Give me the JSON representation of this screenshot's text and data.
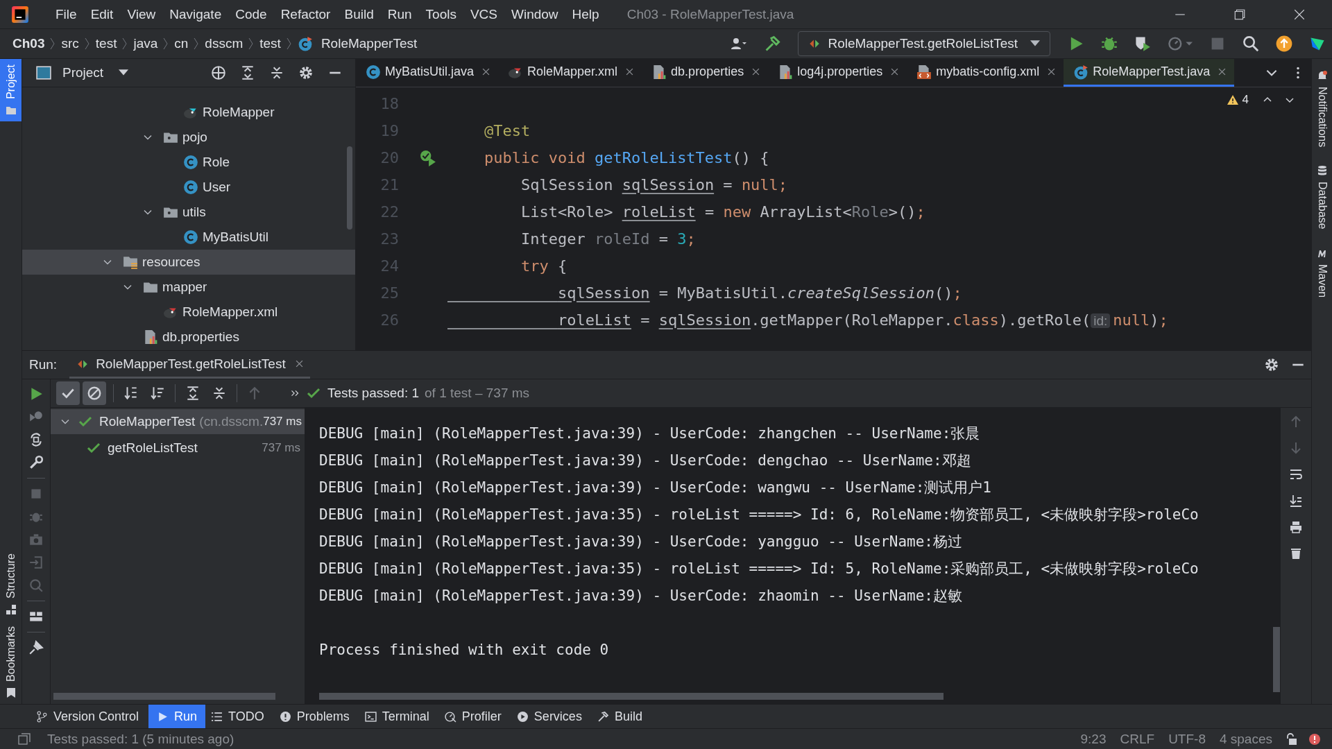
{
  "menu": [
    "File",
    "Edit",
    "View",
    "Navigate",
    "Code",
    "Refactor",
    "Build",
    "Run",
    "Tools",
    "VCS",
    "Window",
    "Help"
  ],
  "window_title": "Ch03 - RoleMapperTest.java",
  "breadcrumbs": [
    {
      "label": "Ch03",
      "kind": "project"
    },
    {
      "label": "src",
      "kind": "dir"
    },
    {
      "label": "test",
      "kind": "dir"
    },
    {
      "label": "java",
      "kind": "dir"
    },
    {
      "label": "cn",
      "kind": "dir"
    },
    {
      "label": "dsscm",
      "kind": "dir"
    },
    {
      "label": "test",
      "kind": "dir"
    },
    {
      "label": "RoleMapperTest",
      "kind": "test-class"
    }
  ],
  "run_config": "RoleMapperTest.getRoleListTest",
  "left_stripe": {
    "top": [
      {
        "label": "Project",
        "selected": true
      }
    ],
    "bottom": [
      {
        "label": "Structure",
        "selected": false
      },
      {
        "label": "Bookmarks",
        "selected": false
      }
    ]
  },
  "right_stripe": [
    {
      "label": "Notifications",
      "kind": "bell"
    },
    {
      "label": "Database",
      "kind": "database"
    },
    {
      "label": "Maven",
      "kind": "maven"
    }
  ],
  "project_panel": {
    "title": "Project",
    "tree_continued": [
      {
        "label": "RoleMapper",
        "kind": "mapper-interface",
        "selected": false
      },
      {
        "label": "pojo",
        "kind": "package",
        "selected": false,
        "expanded": true,
        "children": [
          {
            "label": "Role",
            "kind": "class",
            "selected": false
          },
          {
            "label": "User",
            "kind": "class",
            "selected": false
          }
        ]
      },
      {
        "label": "utils",
        "kind": "package",
        "selected": false,
        "expanded": true,
        "children": [
          {
            "label": "MyBatisUtil",
            "kind": "class",
            "selected": false
          }
        ]
      }
    ],
    "tree": [
      {
        "label": "resources",
        "kind": "resources",
        "selected": true,
        "expanded": true,
        "children": [
          {
            "label": "mapper",
            "kind": "folder",
            "selected": false,
            "expanded": true,
            "children": [
              {
                "label": "RoleMapper.xml",
                "kind": "mapper-xml",
                "selected": false
              }
            ]
          },
          {
            "label": "db.properties",
            "kind": "properties",
            "selected": false
          }
        ]
      }
    ]
  },
  "editor_tabs": [
    {
      "label": "MyBatisUtil.java",
      "kind": "class",
      "selected": false
    },
    {
      "label": "RoleMapper.xml",
      "kind": "mapper-xml",
      "selected": false
    },
    {
      "label": "db.properties",
      "kind": "properties",
      "selected": false
    },
    {
      "label": "log4j.properties",
      "kind": "properties",
      "selected": false
    },
    {
      "label": "mybatis-config.xml",
      "kind": "xml",
      "selected": false
    },
    {
      "label": "RoleMapperTest.java",
      "kind": "test-class",
      "selected": true
    }
  ],
  "editor": {
    "warnings": "4",
    "lines": [
      {
        "number": "18",
        "run_gutter": false
      },
      {
        "number": "19",
        "run_gutter": false,
        "tokens": [
          {
            "text": "    @Test",
            "kind": "annotation"
          }
        ]
      },
      {
        "number": "20",
        "run_gutter": true,
        "tokens": [
          {
            "text": "    public void ",
            "kind": "keyword"
          },
          {
            "text": "getRoleListTest",
            "kind": "decl"
          },
          {
            "text": "() {",
            "kind": "plain"
          }
        ]
      },
      {
        "number": "21",
        "run_gutter": false,
        "tokens": [
          {
            "text": "        SqlSession ",
            "kind": "plain"
          },
          {
            "text": "sqlSession",
            "kind": "var"
          },
          {
            "text": " = ",
            "kind": "plain"
          },
          {
            "text": "null",
            "kind": "keyword"
          },
          {
            "text": ";",
            "kind": "keyword"
          }
        ]
      },
      {
        "number": "22",
        "run_gutter": false,
        "tokens": [
          {
            "text": "        List<Role> ",
            "kind": "plain"
          },
          {
            "text": "roleList",
            "kind": "var"
          },
          {
            "text": " = ",
            "kind": "plain"
          },
          {
            "text": "new ",
            "kind": "keyword"
          },
          {
            "text": "ArrayList<",
            "kind": "plain"
          },
          {
            "text": "Role",
            "kind": "muted"
          },
          {
            "text": ">()",
            "kind": "plain"
          },
          {
            "text": ";",
            "kind": "keyword"
          }
        ]
      },
      {
        "number": "23",
        "run_gutter": false,
        "tokens": [
          {
            "text": "        Integer ",
            "kind": "plain"
          },
          {
            "text": "roleId",
            "kind": "muted"
          },
          {
            "text": " = ",
            "kind": "plain"
          },
          {
            "text": "3",
            "kind": "number"
          },
          {
            "text": ";",
            "kind": "keyword"
          }
        ]
      },
      {
        "number": "24",
        "run_gutter": false,
        "tokens": [
          {
            "text": "        try",
            "kind": "keyword"
          },
          {
            "text": " {",
            "kind": "plain"
          }
        ]
      },
      {
        "number": "25",
        "run_gutter": false,
        "tokens": [
          {
            "text": "            sqlSession",
            "kind": "var"
          },
          {
            "text": " = MyBatisUtil.",
            "kind": "plain"
          },
          {
            "text": "createSqlSession",
            "kind": "static"
          },
          {
            "text": "()",
            "kind": "plain"
          },
          {
            "text": ";",
            "kind": "keyword"
          }
        ]
      },
      {
        "number": "26",
        "run_gutter": false,
        "tokens": [
          {
            "text": "            roleList",
            "kind": "var"
          },
          {
            "text": " = ",
            "kind": "plain"
          },
          {
            "text": "sqlSession",
            "kind": "var"
          },
          {
            "text": ".getMapper(RoleMapper.",
            "kind": "plain"
          },
          {
            "text": "class",
            "kind": "keyword"
          },
          {
            "text": ").getRole(",
            "kind": "plain"
          },
          {
            "text": "id:",
            "kind": "hint"
          },
          {
            "text": "null",
            "kind": "keyword"
          },
          {
            "text": ")",
            "kind": "plain"
          },
          {
            "text": ";",
            "kind": "keyword"
          }
        ]
      }
    ]
  },
  "run_panel": {
    "label": "Run:",
    "tab": "RoleMapperTest.getRoleListTest",
    "filters": [
      {
        "kind": "passed",
        "selected": true
      },
      {
        "kind": "ignored",
        "selected": true
      }
    ],
    "status_main": "Tests passed: 1",
    "status_detail": "of 1 test – 737 ms",
    "tests": [
      {
        "label": "RoleMapperTest",
        "package": "(cn.dsscm.",
        "time": "737 ms",
        "expanded": true,
        "selected": true,
        "children": [
          {
            "label": "getRoleListTest",
            "time": "737 ms",
            "selected": false
          }
        ]
      }
    ],
    "console": [
      {
        "kind": "log",
        "text": "DEBUG [main] (RoleMapperTest.java:39) - UserCode: zhangchen -- UserName:张晨"
      },
      {
        "kind": "log",
        "text": "DEBUG [main] (RoleMapperTest.java:39) - UserCode: dengchao -- UserName:邓超"
      },
      {
        "kind": "log",
        "text": "DEBUG [main] (RoleMapperTest.java:39) - UserCode: wangwu -- UserName:测试用户1"
      },
      {
        "kind": "log",
        "text": "DEBUG [main] (RoleMapperTest.java:35) - roleList =====> Id: 6, RoleName:物资部员工, <未做映射字段>roleCo"
      },
      {
        "kind": "log",
        "text": "DEBUG [main] (RoleMapperTest.java:39) - UserCode: yangguo -- UserName:杨过"
      },
      {
        "kind": "log",
        "text": "DEBUG [main] (RoleMapperTest.java:35) - roleList =====> Id: 5, RoleName:采购部员工, <未做映射字段>roleCo"
      },
      {
        "kind": "log",
        "text": "DEBUG [main] (RoleMapperTest.java:39) - UserCode: zhaomin -- UserName:赵敏"
      },
      {
        "kind": "exit",
        "text": "Process finished with exit code 0"
      }
    ]
  },
  "tool_tabs": [
    {
      "label": "Version Control",
      "kind": "vcs",
      "selected": false
    },
    {
      "label": "Run",
      "kind": "run",
      "selected": true
    },
    {
      "label": "TODO",
      "kind": "todo",
      "selected": false
    },
    {
      "label": "Problems",
      "kind": "problems",
      "selected": false
    },
    {
      "label": "Terminal",
      "kind": "terminal",
      "selected": false
    },
    {
      "label": "Profiler",
      "kind": "profiler",
      "selected": false
    },
    {
      "label": "Services",
      "kind": "services",
      "selected": false
    },
    {
      "label": "Build",
      "kind": "build",
      "selected": false
    }
  ],
  "status_bar": {
    "message": "Tests passed: 1 (5 minutes ago)",
    "items": [
      "9:23",
      "CRLF",
      "UTF-8",
      "4 spaces"
    ]
  }
}
